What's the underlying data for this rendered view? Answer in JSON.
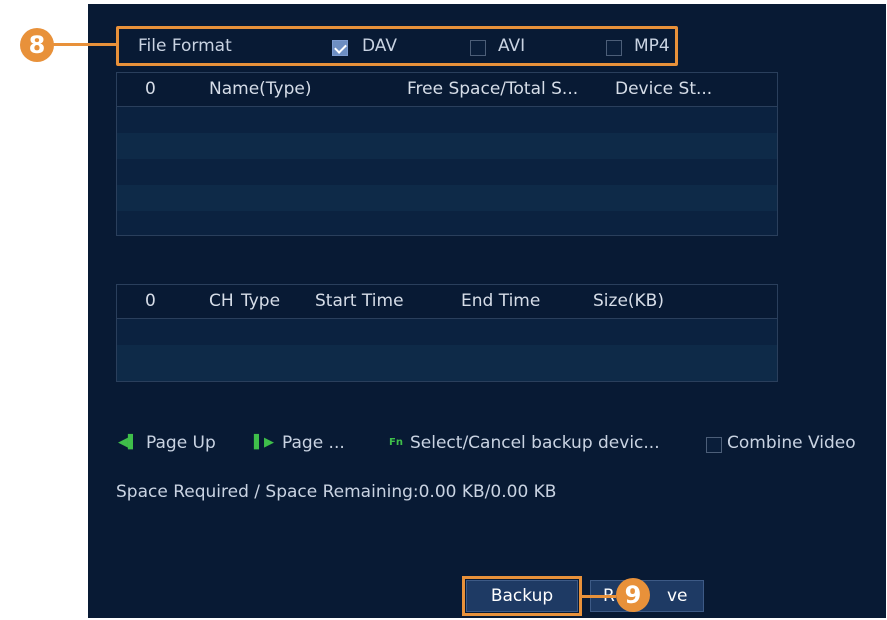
{
  "file_format": {
    "label": "File Format",
    "options": [
      {
        "label": "DAV",
        "checked": true
      },
      {
        "label": "AVI",
        "checked": false
      },
      {
        "label": "MP4",
        "checked": false
      }
    ]
  },
  "device_table": {
    "columns": [
      "0",
      "Name(Type)",
      "Free Space/Total S...",
      "Device St..."
    ]
  },
  "file_table": {
    "columns": [
      "0",
      "CH",
      "Type",
      "Start Time",
      "End Time",
      "Size(KB)"
    ]
  },
  "controls": {
    "page_up": "Page Up",
    "page_down": "Page ...",
    "fn_label": "Fn",
    "select_cancel": "Select/Cancel backup devic...",
    "combine_video": "Combine Video"
  },
  "space_info": "Space Required / Space Remaining:0.00 KB/0.00 KB",
  "buttons": {
    "backup": "Backup",
    "remove_partial_left": "R",
    "remove_partial_right": "ve"
  },
  "callouts": {
    "format": "8",
    "backup": "9"
  },
  "colors": {
    "panel_bg": "#081a34",
    "callout": "#e8913a",
    "icon_green": "#3fbf4a"
  }
}
